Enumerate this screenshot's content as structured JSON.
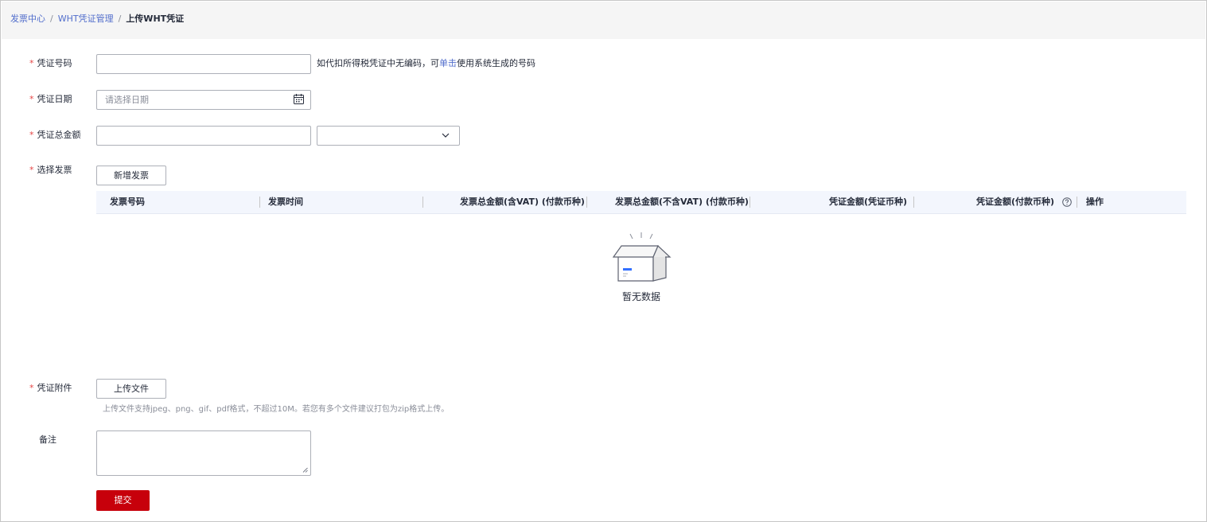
{
  "breadcrumb": {
    "items": [
      "发票中心",
      "WHT凭证管理"
    ],
    "separator": "/",
    "current": "上传WHT凭证"
  },
  "form": {
    "required_mark": "*",
    "voucher_no": {
      "label": "凭证号码",
      "value": "",
      "hint_prefix": "如代扣所得税凭证中无编码，可",
      "hint_link": "单击",
      "hint_suffix": "使用系统生成的号码"
    },
    "voucher_date": {
      "label": "凭证日期",
      "placeholder": "请选择日期",
      "icon": "calendar-icon"
    },
    "voucher_total": {
      "label": "凭证总金额",
      "value": "",
      "currency_selected": ""
    },
    "select_invoice": {
      "label": "选择发票",
      "add_button": "新增发票"
    },
    "attachment": {
      "label": "凭证附件",
      "upload_button": "上传文件",
      "note": "上传文件支持jpeg、png、gif、pdf格式，不超过10M。若您有多个文件建议打包为zip格式上传。"
    },
    "remarks": {
      "label": "备注",
      "value": ""
    },
    "submit_button": "提交"
  },
  "invoice_table": {
    "columns": [
      "发票号码",
      "发票时间",
      "发票总金额(含VAT) (付款币种)",
      "发票总金额(不含VAT) (付款币种)",
      "凭证金额(凭证币种)",
      "凭证金额(付款币种)",
      "操作"
    ],
    "rows": [],
    "empty_text": "暂无数据"
  },
  "colors": {
    "primary": "#c7000b",
    "link": "#526ecc",
    "required": "#e54545",
    "table_header_bg": "#f3f6fd",
    "empty_icon_accent": "#3370ff"
  }
}
